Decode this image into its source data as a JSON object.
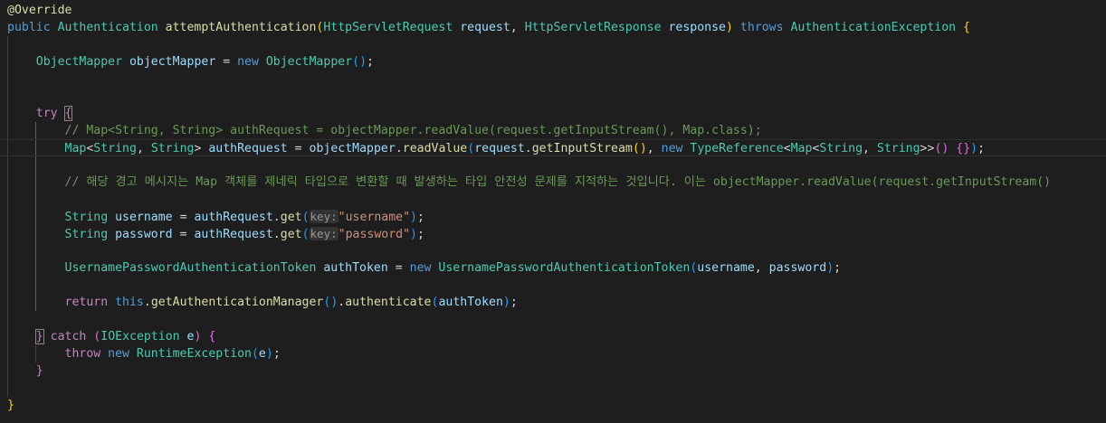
{
  "lines": [
    {
      "tokens": [
        {
          "t": "@Override",
          "c": "anno"
        }
      ]
    },
    {
      "tokens": [
        {
          "t": "public ",
          "c": "kw"
        },
        {
          "t": "Authentication ",
          "c": "type"
        },
        {
          "t": "attemptAuthentication",
          "c": "fn"
        },
        {
          "t": "(",
          "c": "brace1"
        },
        {
          "t": "HttpServletRequest ",
          "c": "type"
        },
        {
          "t": "request",
          "c": "var"
        },
        {
          "t": ", ",
          "c": "plain"
        },
        {
          "t": "HttpServletResponse ",
          "c": "type"
        },
        {
          "t": "response",
          "c": "var"
        },
        {
          "t": ") ",
          "c": "brace1"
        },
        {
          "t": "throws ",
          "c": "kw"
        },
        {
          "t": "AuthenticationException ",
          "c": "type"
        },
        {
          "t": "{",
          "c": "brace1"
        }
      ]
    },
    {
      "tokens": []
    },
    {
      "tokens": [
        {
          "t": "    ObjectMapper ",
          "c": "type"
        },
        {
          "t": "objectMapper",
          "c": "var"
        },
        {
          "t": " = ",
          "c": "plain"
        },
        {
          "t": "new ",
          "c": "kw"
        },
        {
          "t": "ObjectMapper",
          "c": "type"
        },
        {
          "t": "()",
          "c": "brace3"
        },
        {
          "t": ";",
          "c": "plain"
        }
      ]
    },
    {
      "tokens": []
    },
    {
      "tokens": []
    },
    {
      "tokens": [
        {
          "t": "    try ",
          "c": "ctrl"
        },
        {
          "t": "{",
          "c": "brace2",
          "match": true
        }
      ]
    },
    {
      "tokens": [
        {
          "t": "        // Map<String, String> authRequest = objectMapper.readValue(request.getInputStream(), Map.class);",
          "c": "cmt"
        }
      ]
    },
    {
      "tokens": [
        {
          "t": "        Map",
          "c": "type"
        },
        {
          "t": "<",
          "c": "plain"
        },
        {
          "t": "String",
          "c": "type"
        },
        {
          "t": ", ",
          "c": "plain"
        },
        {
          "t": "String",
          "c": "type"
        },
        {
          "t": "> ",
          "c": "plain"
        },
        {
          "t": "authRequest",
          "c": "var"
        },
        {
          "t": " = ",
          "c": "plain"
        },
        {
          "t": "objectMapper",
          "c": "var"
        },
        {
          "t": ".",
          "c": "plain"
        },
        {
          "t": "readValue",
          "c": "fn"
        },
        {
          "t": "(",
          "c": "brace3"
        },
        {
          "t": "request",
          "c": "var"
        },
        {
          "t": ".",
          "c": "plain"
        },
        {
          "t": "getInputStream",
          "c": "fn"
        },
        {
          "t": "()",
          "c": "brace1"
        },
        {
          "t": ", ",
          "c": "plain"
        },
        {
          "t": "new ",
          "c": "kw"
        },
        {
          "t": "TypeReference",
          "c": "type"
        },
        {
          "t": "<",
          "c": "plain"
        },
        {
          "t": "Map",
          "c": "type"
        },
        {
          "t": "<",
          "c": "plain"
        },
        {
          "t": "String",
          "c": "type"
        },
        {
          "t": ", ",
          "c": "plain"
        },
        {
          "t": "String",
          "c": "type"
        },
        {
          "t": ">>",
          "c": "plain"
        },
        {
          "t": "() {}",
          "c": "brace2"
        },
        {
          "t": ")",
          "c": "brace3"
        },
        {
          "t": ";",
          "c": "plain"
        }
      ],
      "current": true
    },
    {
      "tokens": []
    },
    {
      "tokens": [
        {
          "t": "        // 해당 경고 메시지는 Map 객체를 제네릭 타입으로 변환할 때 발생하는 타입 안전성 문제를 지적하는 것입니다. 이는 objectMapper.readValue(request.getInputStream()",
          "c": "cmt"
        }
      ]
    },
    {
      "tokens": []
    },
    {
      "tokens": [
        {
          "t": "        String ",
          "c": "type"
        },
        {
          "t": "username",
          "c": "var"
        },
        {
          "t": " = ",
          "c": "plain"
        },
        {
          "t": "authRequest",
          "c": "var"
        },
        {
          "t": ".",
          "c": "plain"
        },
        {
          "t": "get",
          "c": "fn"
        },
        {
          "t": "(",
          "c": "brace3"
        },
        {
          "t": "key:",
          "c": "hint"
        },
        {
          "t": "\"username\"",
          "c": "str"
        },
        {
          "t": ")",
          "c": "brace3"
        },
        {
          "t": ";",
          "c": "plain"
        }
      ]
    },
    {
      "tokens": [
        {
          "t": "        String ",
          "c": "type"
        },
        {
          "t": "password",
          "c": "var"
        },
        {
          "t": " = ",
          "c": "plain"
        },
        {
          "t": "authRequest",
          "c": "var"
        },
        {
          "t": ".",
          "c": "plain"
        },
        {
          "t": "get",
          "c": "fn"
        },
        {
          "t": "(",
          "c": "brace3"
        },
        {
          "t": "key:",
          "c": "hint"
        },
        {
          "t": "\"password\"",
          "c": "str"
        },
        {
          "t": ")",
          "c": "brace3"
        },
        {
          "t": ";",
          "c": "plain"
        }
      ]
    },
    {
      "tokens": []
    },
    {
      "tokens": [
        {
          "t": "        UsernamePasswordAuthenticationToken ",
          "c": "type"
        },
        {
          "t": "authToken",
          "c": "var"
        },
        {
          "t": " = ",
          "c": "plain"
        },
        {
          "t": "new ",
          "c": "kw"
        },
        {
          "t": "UsernamePasswordAuthenticationToken",
          "c": "type"
        },
        {
          "t": "(",
          "c": "brace3"
        },
        {
          "t": "username",
          "c": "var"
        },
        {
          "t": ", ",
          "c": "plain"
        },
        {
          "t": "password",
          "c": "var"
        },
        {
          "t": ")",
          "c": "brace3"
        },
        {
          "t": ";",
          "c": "plain"
        }
      ]
    },
    {
      "tokens": []
    },
    {
      "tokens": [
        {
          "t": "        return ",
          "c": "ctrl"
        },
        {
          "t": "this",
          "c": "kw"
        },
        {
          "t": ".",
          "c": "plain"
        },
        {
          "t": "getAuthenticationManager",
          "c": "fn"
        },
        {
          "t": "()",
          "c": "brace3"
        },
        {
          "t": ".",
          "c": "plain"
        },
        {
          "t": "authenticate",
          "c": "fn"
        },
        {
          "t": "(",
          "c": "brace3"
        },
        {
          "t": "authToken",
          "c": "var"
        },
        {
          "t": ")",
          "c": "brace3"
        },
        {
          "t": ";",
          "c": "plain"
        }
      ]
    },
    {
      "tokens": []
    },
    {
      "tokens": [
        {
          "t": "    ",
          "c": "plain"
        },
        {
          "t": "}",
          "c": "brace2",
          "match": true
        },
        {
          "t": " catch ",
          "c": "ctrl"
        },
        {
          "t": "(",
          "c": "brace2"
        },
        {
          "t": "IOException ",
          "c": "type"
        },
        {
          "t": "e",
          "c": "var"
        },
        {
          "t": ") {",
          "c": "brace2"
        }
      ]
    },
    {
      "tokens": [
        {
          "t": "        throw ",
          "c": "ctrl"
        },
        {
          "t": "new ",
          "c": "kw"
        },
        {
          "t": "RuntimeException",
          "c": "type"
        },
        {
          "t": "(",
          "c": "brace3"
        },
        {
          "t": "e",
          "c": "var"
        },
        {
          "t": ")",
          "c": "brace3"
        },
        {
          "t": ";",
          "c": "plain"
        }
      ]
    },
    {
      "tokens": [
        {
          "t": "    }",
          "c": "brace2"
        }
      ]
    },
    {
      "tokens": []
    },
    {
      "tokens": [
        {
          "t": "}",
          "c": "brace1"
        }
      ]
    }
  ]
}
